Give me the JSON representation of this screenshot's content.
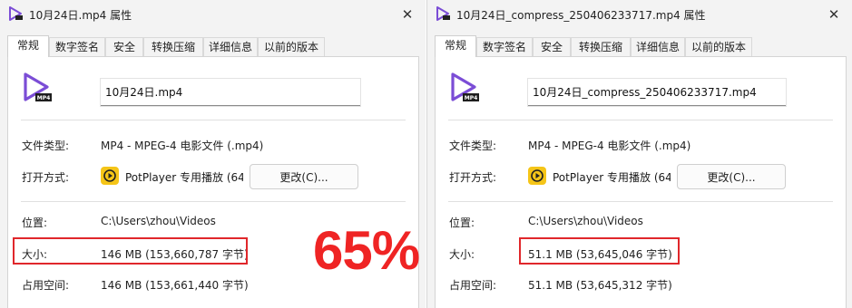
{
  "left": {
    "title": "10月24日.mp4 属性",
    "tabs": [
      "常规",
      "数字签名",
      "安全",
      "转换压缩",
      "详细信息",
      "以前的版本"
    ],
    "file_name": "10月24日.mp4",
    "file_type_label": "文件类型:",
    "file_type_value": "MP4 - MPEG-4 电影文件 (.mp4)",
    "open_with_label": "打开方式:",
    "open_with_value": "PotPlayer 专用播放 (64",
    "change_button": "更改(C)...",
    "location_label": "位置:",
    "location_value": "C:\\Users\\zhou\\Videos",
    "size_label": "大小:",
    "size_value": "146 MB (153,660,787 字节)",
    "disk_size_label": "占用空间:",
    "disk_size_value": "146 MB (153,661,440 字节)"
  },
  "right": {
    "title": "10月24日_compress_250406233717.mp4 属性",
    "tabs": [
      "常规",
      "数字签名",
      "安全",
      "转换压缩",
      "详细信息",
      "以前的版本"
    ],
    "file_name": "10月24日_compress_250406233717.mp4",
    "file_type_label": "文件类型:",
    "file_type_value": "MP4 - MPEG-4 电影文件 (.mp4)",
    "open_with_label": "打开方式:",
    "open_with_value": "PotPlayer 专用播放 (64",
    "change_button": "更改(C)...",
    "location_label": "位置:",
    "location_value": "C:\\Users\\zhou\\Videos",
    "size_label": "大小:",
    "size_value": "51.1 MB (53,645,046 字节)",
    "disk_size_label": "占用空间:",
    "disk_size_value": "51.1 MB (53,645,312 字节)"
  },
  "overlay": {
    "percent": "65%"
  },
  "icons": {
    "title": "video-file-icon",
    "file": "video-file-icon",
    "app": "potplayer-icon",
    "close": "close-icon"
  },
  "colors": {
    "accent_purple": "#7b4dd6",
    "highlight_red": "#e0272b",
    "percent_red": "#ef2424",
    "potplayer_yellow": "#f5c518"
  }
}
